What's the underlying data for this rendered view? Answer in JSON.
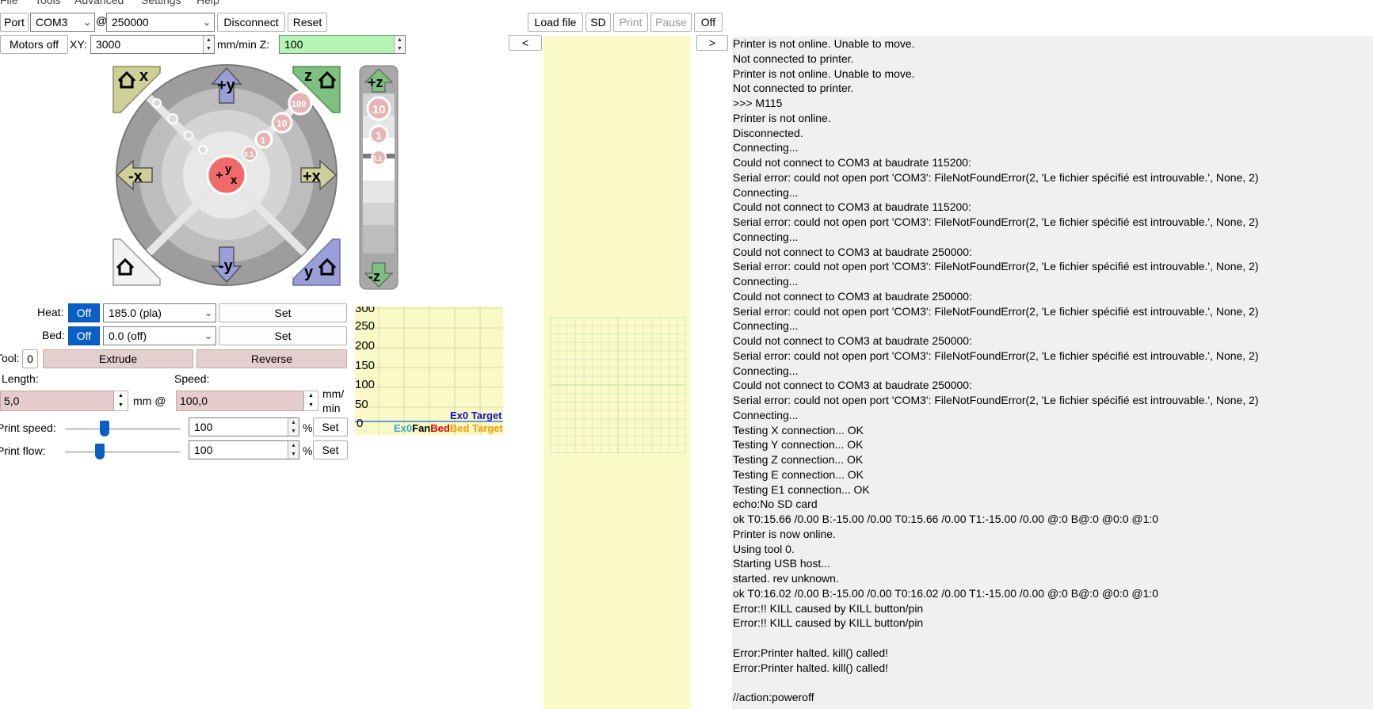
{
  "menu": [
    "File",
    "Tools",
    "Advanced",
    "Settings",
    "Help"
  ],
  "toolbar": {
    "port_label": "Port",
    "port_value": "COM3",
    "at": "@",
    "baud_value": "250000",
    "disconnect": "Disconnect",
    "reset": "Reset",
    "load_file": "Load file",
    "sd": "SD",
    "print": "Print",
    "pause": "Pause",
    "off": "Off"
  },
  "motion": {
    "motors_off": "Motors off",
    "xy_label": "XY:",
    "xy_value": "3000",
    "mmmin_z": "mm/min Z:",
    "z_value": "100"
  },
  "jog": {
    "home_x": "x",
    "home_z": "z",
    "home_y": "y",
    "plus_y": "+y",
    "minus_y": "-y",
    "plus_x": "+x",
    "minus_x": "-x",
    "step_100": "100",
    "step_10": "10",
    "step_1": "1",
    "step_01": "0.1",
    "center_y": "y",
    "center_x": "x",
    "plus_z": "+z",
    "minus_z": "-z",
    "z10": "10",
    "z1": "1",
    "z01": "0.1"
  },
  "heat": {
    "heat_label": "Heat:",
    "heat_toggle": "Off",
    "heat_value": "185.0 (pla)",
    "heat_set": "Set",
    "bed_label": "Bed:",
    "bed_toggle": "Off",
    "bed_value": "0.0 (off)",
    "bed_set": "Set"
  },
  "extrude": {
    "tool_label": "Tool:",
    "tool_value": "0",
    "extrude": "Extrude",
    "reverse": "Reverse",
    "length_label": "Length:",
    "speed_label": "Speed:",
    "length_value": "5,0",
    "mm_at": "mm @",
    "speed_value": "100,0",
    "mm_min_1": "mm/",
    "mm_min_2": "min"
  },
  "print_speed": {
    "label": "Print speed:",
    "value": "100",
    "pct": "%",
    "set": "Set",
    "slider_level": 0.34
  },
  "print_flow": {
    "label": "Print flow:",
    "value": "100",
    "pct": "%",
    "set": "Set",
    "slider_level": 0.3
  },
  "temp_graph": {
    "ticks": [
      "300",
      "250",
      "200",
      "150",
      "100",
      "50",
      "0"
    ],
    "legend_top": "Ex0 Target",
    "legend_ex0": "Ex0",
    "legend_fan": "Fan",
    "legend_bed": "Bed",
    "legend_bedtarget": "Bed Target"
  },
  "nav": {
    "left": "<",
    "right": ">"
  },
  "colors": {
    "accent": "#0a5fc4",
    "panel_yellow": "#fafac8",
    "z_green": "#b4f5b4",
    "pink": "#e6cccc"
  },
  "log": [
    "Printer is not online. Unable to move.",
    "Not connected to printer.",
    "Printer is not online. Unable to move.",
    "Not connected to printer.",
    ">>> M115",
    "Printer is not online.",
    "Disconnected.",
    "Connecting...",
    "Could not connect to COM3 at baudrate 115200:",
    "Serial error: could not open port 'COM3': FileNotFoundError(2, 'Le fichier spécifié est introuvable.', None, 2)",
    "Connecting...",
    "Could not connect to COM3 at baudrate 115200:",
    "Serial error: could not open port 'COM3': FileNotFoundError(2, 'Le fichier spécifié est introuvable.', None, 2)",
    "Connecting...",
    "Could not connect to COM3 at baudrate 250000:",
    "Serial error: could not open port 'COM3': FileNotFoundError(2, 'Le fichier spécifié est introuvable.', None, 2)",
    "Connecting...",
    "Could not connect to COM3 at baudrate 250000:",
    "Serial error: could not open port 'COM3': FileNotFoundError(2, 'Le fichier spécifié est introuvable.', None, 2)",
    "Connecting...",
    "Could not connect to COM3 at baudrate 250000:",
    "Serial error: could not open port 'COM3': FileNotFoundError(2, 'Le fichier spécifié est introuvable.', None, 2)",
    "Connecting...",
    "Could not connect to COM3 at baudrate 250000:",
    "Serial error: could not open port 'COM3': FileNotFoundError(2, 'Le fichier spécifié est introuvable.', None, 2)",
    "Connecting...",
    "Testing X connection... OK",
    "Testing Y connection... OK",
    "Testing Z connection... OK",
    "Testing E connection... OK",
    "Testing E1 connection... OK",
    "echo:No SD card",
    "ok T0:15.66 /0.00 B:-15.00 /0.00 T0:15.66 /0.00 T1:-15.00 /0.00 @:0 B@:0 @0:0 @1:0",
    "Printer is now online.",
    "Using tool 0.",
    "Starting USB host...",
    "started. rev unknown.",
    "ok T0:16.02 /0.00 B:-15.00 /0.00 T0:16.02 /0.00 T1:-15.00 /0.00 @:0 B@:0 @0:0 @1:0",
    "Error:!! KILL caused by KILL button/pin",
    "Error:!! KILL caused by KILL button/pin",
    "",
    "Error:Printer halted. kill() called!",
    "Error:Printer halted. kill() called!",
    "",
    "//action:poweroff"
  ]
}
